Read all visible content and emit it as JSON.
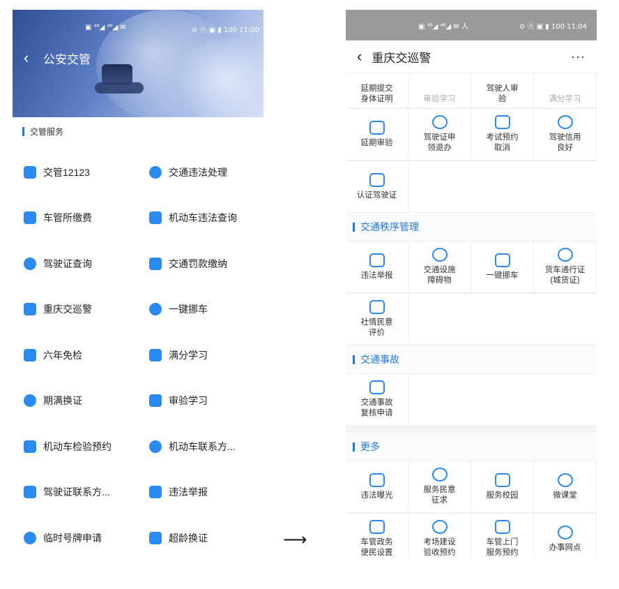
{
  "left": {
    "status": {
      "icons": "▣ ⁴⁶◢ ⁴⁶◢ ✉",
      "right": "⊘ ⓝ ▣ ▮ 100 11:00"
    },
    "header": {
      "back_icon": "‹",
      "title": "公安交管"
    },
    "section": "交管服务",
    "services": [
      {
        "label": "交管12123",
        "icon": "card-icon"
      },
      {
        "label": "交通违法处理",
        "icon": "ticket-icon"
      },
      {
        "label": "车管所缴费",
        "icon": "payment-icon"
      },
      {
        "label": "机动车违法查询",
        "icon": "search-icon"
      },
      {
        "label": "驾驶证查询",
        "icon": "license-icon"
      },
      {
        "label": "交通罚款缴纳",
        "icon": "car-fine-icon"
      },
      {
        "label": "重庆交巡警",
        "icon": "police-cap-icon"
      },
      {
        "label": "一键挪车",
        "icon": "move-car-icon"
      },
      {
        "label": "六年免检",
        "icon": "inspection-icon"
      },
      {
        "label": "满分学习",
        "icon": "study-icon"
      },
      {
        "label": "期满换证",
        "icon": "renew-icon"
      },
      {
        "label": "审验学习",
        "icon": "wheel-icon"
      },
      {
        "label": "机动车检验预约",
        "icon": "car-icon"
      },
      {
        "label": "机动车联系方...",
        "icon": "car-contact-icon"
      },
      {
        "label": "驾驶证联系方...",
        "icon": "wheel-contact-icon"
      },
      {
        "label": "违法举报",
        "icon": "report-icon"
      },
      {
        "label": "临时号牌申请",
        "icon": "plate-icon"
      },
      {
        "label": "超龄换证",
        "icon": "age-renew-icon"
      }
    ]
  },
  "arrow": "⟶",
  "right": {
    "status": {
      "left": "▣ ⁴⁶◢ ⁴⁶◢ ✉ 人",
      "right": "⊘ ⓝ ▣ ▮ 100 11:04"
    },
    "header": {
      "back_icon": "‹",
      "title": "重庆交巡警",
      "more_icon": "···"
    },
    "top_tiles": [
      "延期提交\n身体证明",
      "审验学习",
      "驾驶人审\n验",
      "满分学习"
    ],
    "tiles_row2": [
      "延期审验",
      "驾驶证申\n领退办",
      "考试预约\n取消",
      "驾驶信用\n良好"
    ],
    "tiles_row3": [
      "认证驾驶证"
    ],
    "sections": [
      {
        "title": "交通秩序管理",
        "rows": [
          [
            "违法举报",
            "交通设施\n障碍物",
            "一键挪车",
            "货车通行证\n(城货证)"
          ],
          [
            "社情民意\n评价"
          ]
        ]
      },
      {
        "title": "交通事故",
        "rows": [
          [
            "交通事故\n复核申请"
          ]
        ]
      },
      {
        "title": "更多",
        "rows": [
          [
            "违法曝光",
            "服务民意\n征求",
            "服务校园",
            "微课堂"
          ],
          [
            "车管政务\n便民设置",
            "考场建设\n验收预约",
            "车管上门\n服务预约",
            "办事网点"
          ]
        ]
      }
    ]
  }
}
